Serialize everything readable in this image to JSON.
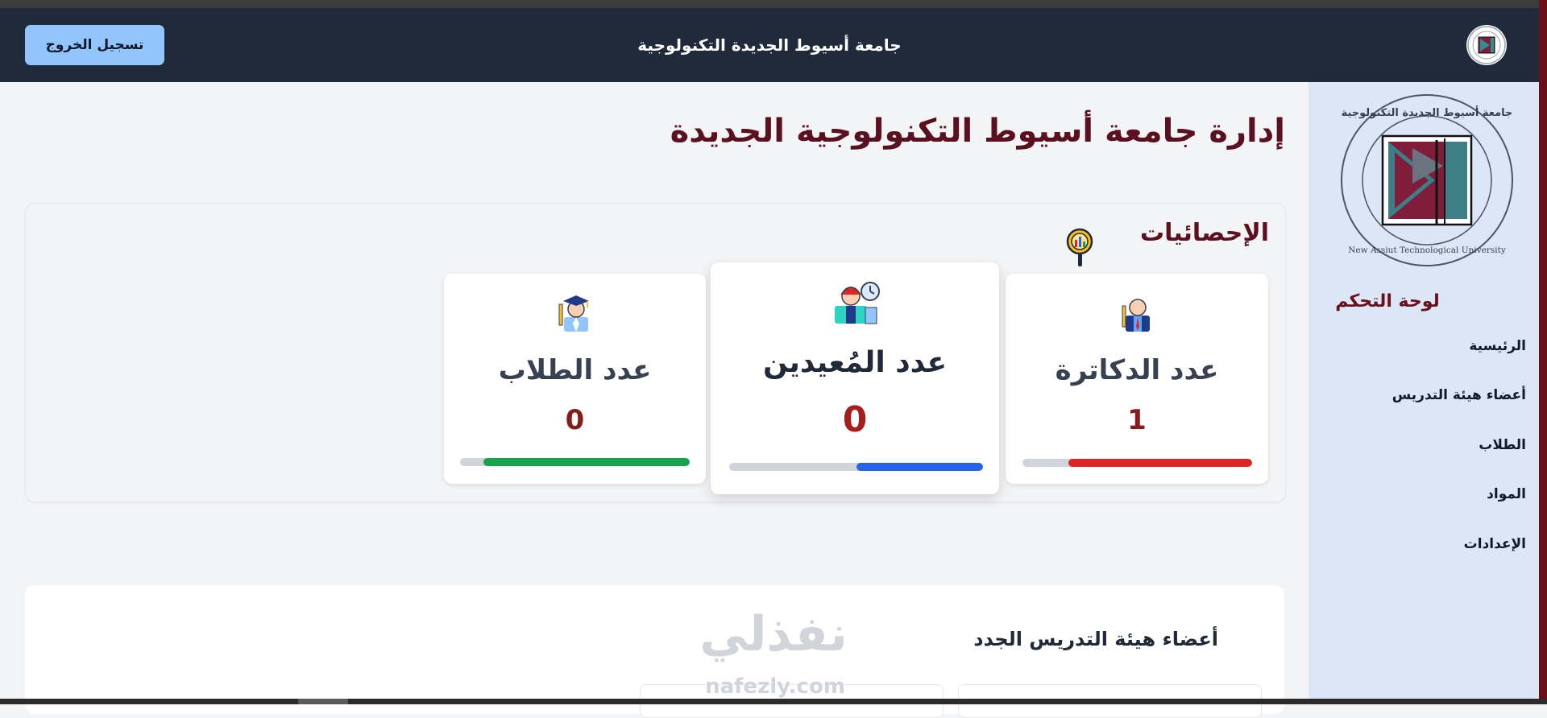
{
  "navbar": {
    "title": "جامعة أسيوط الجديدة التكنولوجية",
    "logout_label": "تسجيل الخروج"
  },
  "sidebar": {
    "logo_text": {
      "arabic": "جامعة أسيوط الجديدة التكنولوجية",
      "english": "New Assiut Technological University"
    },
    "heading": "لوحة التحكم",
    "items": [
      {
        "label": "الرئيسية"
      },
      {
        "label": "أعضاء هيئة التدريس"
      },
      {
        "label": "الطلاب"
      },
      {
        "label": "المواد"
      },
      {
        "label": "الإعدادات"
      }
    ]
  },
  "main": {
    "page_title": "إدارة جامعة أسيوط التكنولوجية الجديدة",
    "stats": {
      "heading": "الإحصائيات",
      "cards": [
        {
          "label": "عدد الدكاترة",
          "value": "1",
          "progress": 0.8,
          "color": "#dc2626",
          "icon": "professor-icon"
        },
        {
          "label": "عدد المُعيدين",
          "value": "0",
          "progress": 0.5,
          "color": "#2563eb",
          "icon": "teaching-assistant-icon"
        },
        {
          "label": "عدد الطلاب",
          "value": "0",
          "progress": 0.9,
          "color": "#16a34a",
          "icon": "graduate-student-icon"
        }
      ]
    },
    "new_faculty": {
      "heading": "أعضاء هيئة التدريس الجدد"
    }
  },
  "watermark": {
    "arabic": "نفذلي",
    "latin": "nafezly.com"
  },
  "colors": {
    "navbar": "#1f2a3a",
    "accent": "#6b0f1a",
    "sidebar": "#dbe6f7",
    "title": "#5b1020"
  }
}
